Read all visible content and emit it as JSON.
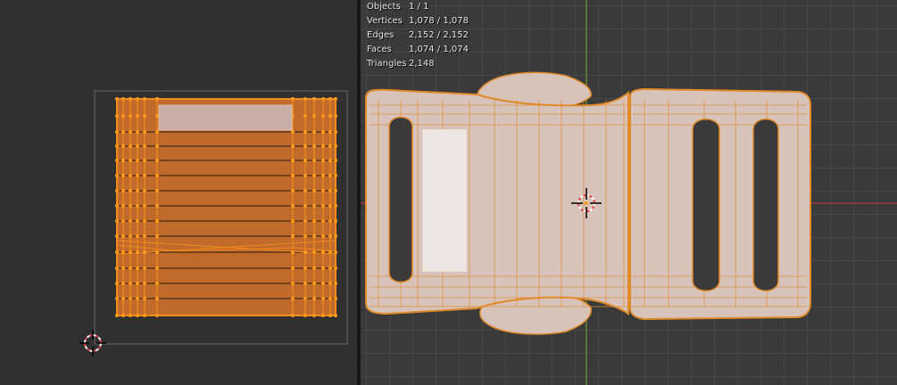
{
  "uv_editor": {
    "background": "#303030",
    "uv_fill": "#c06a2c",
    "uv_edge": "#f08a1c",
    "selected_face": "#c9aea7"
  },
  "viewport": {
    "background": "#3a3a3a",
    "mesh_color": "#d8c3bb",
    "wire_color": "#e08a2a",
    "x_axis_color": "#a63a40",
    "y_axis_color": "#6a9a2e",
    "stats": {
      "objects_label": "Objects",
      "objects_value": "1 / 1",
      "vertices_label": "Vertices",
      "vertices_value": "1,078 / 1,078",
      "edges_label": "Edges",
      "edges_value": "2,152 / 2,152",
      "faces_label": "Faces",
      "faces_value": "1,074 / 1,074",
      "triangles_label": "Triangles",
      "triangles_value": "2,148"
    }
  },
  "icons": [
    "2d-cursor-icon",
    "3d-cursor-icon"
  ]
}
